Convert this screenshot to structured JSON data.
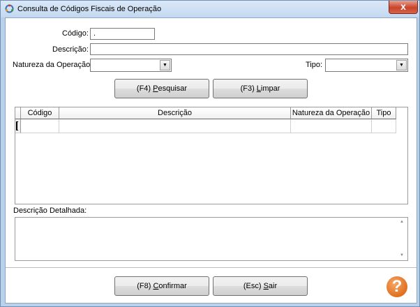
{
  "window": {
    "title": "Consulta de Códigos Fiscais de Operação",
    "close_label": "x"
  },
  "form": {
    "codigo_label": "Código:",
    "codigo_value": ".",
    "descricao_label": "Descrição:",
    "descricao_value": "",
    "natureza_label": "Natureza da Operação:",
    "natureza_value": "",
    "tipo_label": "Tipo:",
    "tipo_value": ""
  },
  "actions": {
    "pesquisar_prefix": "(F4) ",
    "pesquisar_key": "P",
    "pesquisar_rest": "esquisar",
    "limpar_prefix": "(F3) ",
    "limpar_key": "L",
    "limpar_rest": "impar"
  },
  "grid": {
    "columns": [
      "Código",
      "Descrição",
      "Natureza da Operação",
      "Tipo"
    ],
    "rows": []
  },
  "detail": {
    "label": "Descrição Detalhada:",
    "value": ""
  },
  "footer": {
    "confirmar_prefix": "(F8) ",
    "confirmar_key": "C",
    "confirmar_rest": "onfirmar",
    "sair_prefix": "(Esc) ",
    "sair_key": "S",
    "sair_rest": "air",
    "help_glyph": "?"
  },
  "colors": {
    "titlebar": "#c3d8f0",
    "close": "#c9442a",
    "help": "#e0701e"
  }
}
